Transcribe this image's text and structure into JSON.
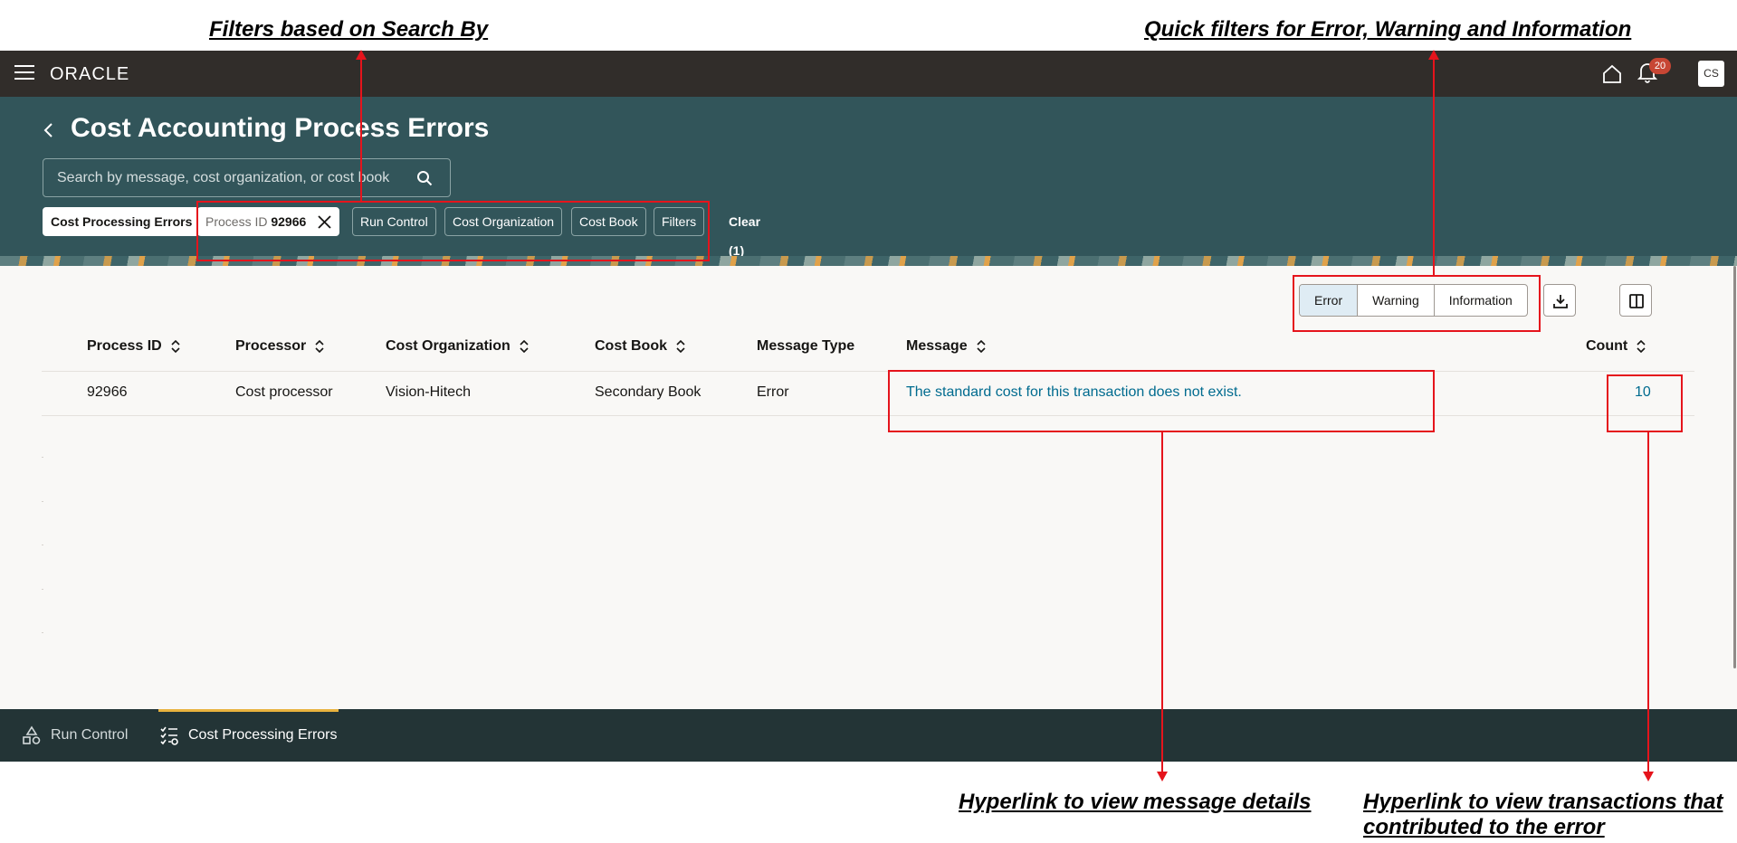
{
  "annotations": {
    "filters": "Filters based on Search By",
    "quick_filters": "Quick filters for Error, Warning and Information",
    "message_link": "Hyperlink to view message details",
    "transactions_link": "Hyperlink to view transactions that contributed to the error"
  },
  "topbar": {
    "logo": "ORACLE",
    "notification_count": "20",
    "user_initials": "CS"
  },
  "header": {
    "title": "Cost Accounting Process Errors",
    "search_placeholder": "Search by message, cost organization, or cost book",
    "chips": {
      "cost_processing_errors": "Cost Processing Errors",
      "process_id_label": "Process ID",
      "process_id_value": "92966",
      "run_control": "Run Control",
      "cost_organization": "Cost Organization",
      "cost_book": "Cost Book",
      "filters": "Filters",
      "clear": "Clear (1)"
    }
  },
  "quick_filters": {
    "error": "Error",
    "warning": "Warning",
    "information": "Information",
    "selected": "Error"
  },
  "table": {
    "columns": {
      "process_id": "Process ID",
      "processor": "Processor",
      "cost_organization": "Cost Organization",
      "cost_book": "Cost Book",
      "message_type": "Message Type",
      "message": "Message",
      "count": "Count"
    },
    "rows": [
      {
        "process_id": "92966",
        "processor": "Cost processor",
        "cost_organization": "Vision-Hitech",
        "cost_book": "Secondary Book",
        "message_type": "Error",
        "message": "The standard cost for this transaction does not exist.",
        "count": "10"
      }
    ]
  },
  "footer": {
    "run_control": "Run Control",
    "cost_processing_errors": "Cost Processing Errors"
  },
  "colors": {
    "topbar": "#312d2a",
    "header": "#32555a",
    "link": "#006b8f",
    "annotation": "#e5141c",
    "footer": "#233436",
    "footer_active": "#e8b23e"
  }
}
